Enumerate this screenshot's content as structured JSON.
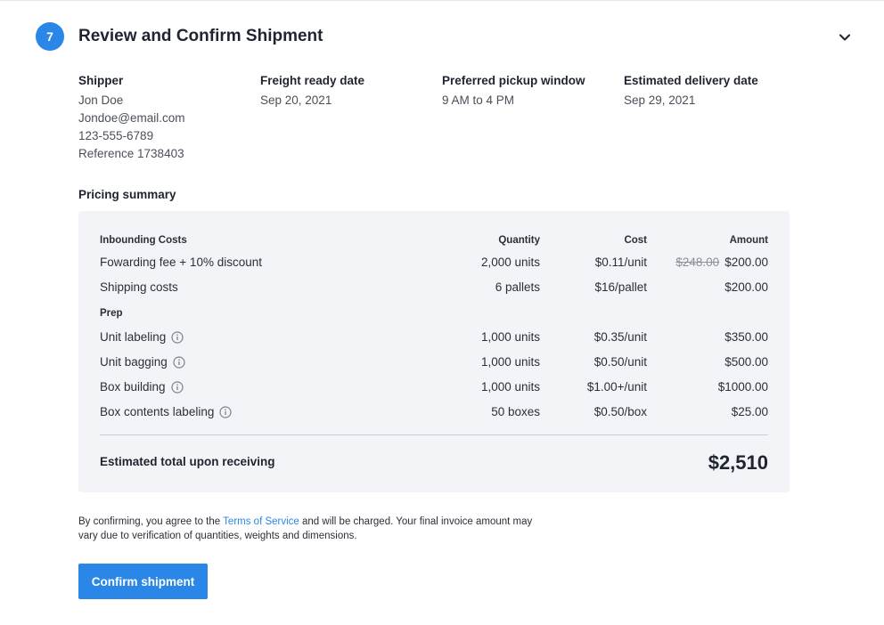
{
  "header": {
    "step_number": "7",
    "title": "Review and Confirm Shipment"
  },
  "shipper": {
    "heading": "Shipper",
    "name": "Jon Doe",
    "email": "Jondoe@email.com",
    "phone": "123-555-6789",
    "reference": "Reference 1738403"
  },
  "freight_ready": {
    "heading": "Freight ready date",
    "value": "Sep 20, 2021"
  },
  "pickup_window": {
    "heading": "Preferred pickup window",
    "value": "9 AM to 4 PM"
  },
  "delivery": {
    "heading": "Estimated delivery date",
    "value": "Sep 29, 2021"
  },
  "pricing": {
    "title": "Pricing summary",
    "columns": {
      "section1": "Inbounding Costs",
      "quantity": "Quantity",
      "cost": "Cost",
      "amount": "Amount"
    },
    "inbounding": [
      {
        "label": "Fowarding fee + 10% discount",
        "quantity": "2,000 units",
        "cost": "$0.11/unit",
        "original_amount": "$248.00",
        "amount": "$200.00"
      },
      {
        "label": "Shipping costs",
        "quantity": "6 pallets",
        "cost": "$16/pallet",
        "amount": "$200.00"
      }
    ],
    "prep_heading": "Prep",
    "prep": [
      {
        "label": "Unit labeling",
        "quantity": "1,000 units",
        "cost": "$0.35/unit",
        "amount": "$350.00"
      },
      {
        "label": "Unit bagging",
        "quantity": "1,000 units",
        "cost": "$0.50/unit",
        "amount": "$500.00"
      },
      {
        "label": "Box building",
        "quantity": "1,000 units",
        "cost": "$1.00+/unit",
        "amount": "$1000.00"
      },
      {
        "label": "Box contents labeling",
        "quantity": "50 boxes",
        "cost": "$0.50/box",
        "amount": "$25.00"
      }
    ],
    "total_label": "Estimated total upon receiving",
    "total_value": "$2,510"
  },
  "legal": {
    "before": "By confirming, you agree to the ",
    "link": "Terms of Service",
    "after": " and will be charged. Your final invoice amount may vary due to verification of quantities, weights and dimensions."
  },
  "actions": {
    "confirm_label": "Confirm shipment"
  },
  "colors": {
    "accent": "#2a87e8",
    "panel": "#f2f4f7"
  }
}
